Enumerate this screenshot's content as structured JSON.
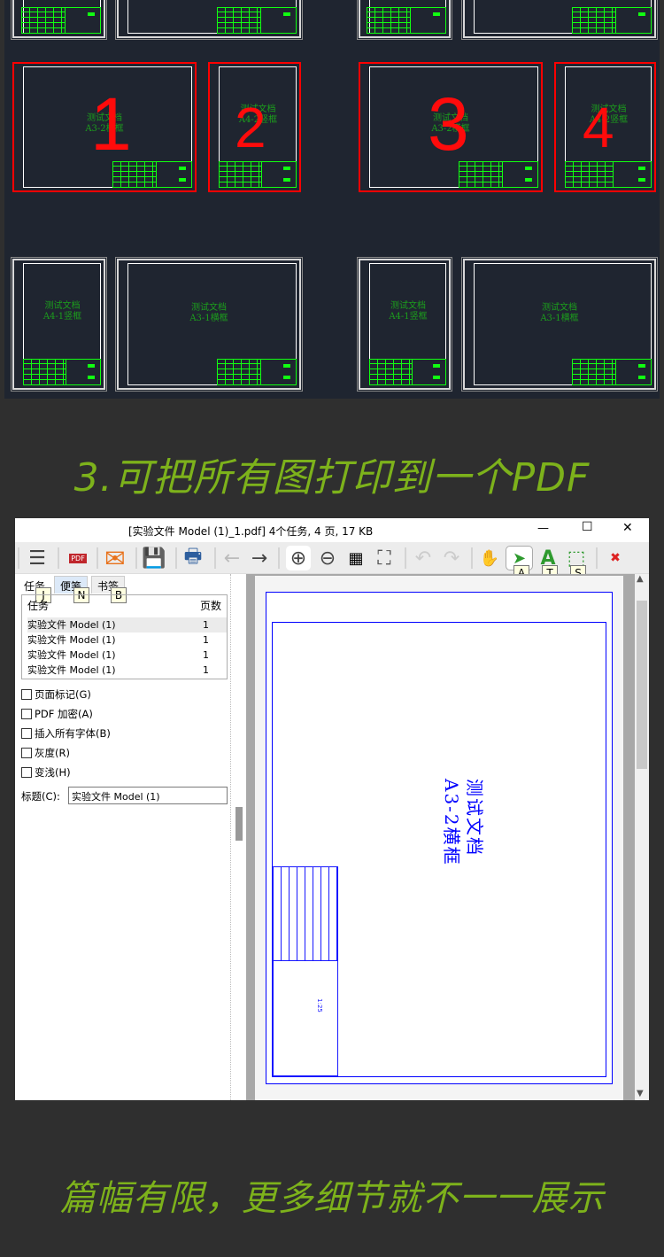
{
  "cad": {
    "frames": [
      {
        "label1": "测试文档",
        "label2": "A3-2横框",
        "number": "1"
      },
      {
        "label1": "测试文档",
        "label2": "A4-2竖框",
        "number": "2"
      },
      {
        "label1": "测试文档",
        "label2": "A3-2横框",
        "number": "3"
      },
      {
        "label1": "测试文档",
        "label2": "A4-2竖框",
        "number": "4"
      },
      {
        "label1": "测试文档",
        "label2": "A4-1竖框"
      },
      {
        "label1": "测试文档",
        "label2": "A3-1横框"
      },
      {
        "label1": "测试文档",
        "label2": "A4-1竖框"
      },
      {
        "label1": "测试文档",
        "label2": "A3-1横框"
      }
    ],
    "colors": {
      "background": "#1f2530",
      "line": "#11ff11",
      "selection": "#ff0000"
    }
  },
  "headline1": "3.可把所有图打印到一个PDF",
  "headline2": "篇幅有限，更多细节就不一一展示",
  "window": {
    "title": "[实验文件 Model (1)_1.pdf] 4个任务, 4 页, 17 KB",
    "controls": {
      "minimize": "—",
      "maximize": "☐",
      "close": "✕"
    },
    "toolbar": {
      "menu": "☰",
      "pdf_icon": "PDF",
      "mail": "✉",
      "save": "💾",
      "print": "🖶",
      "back": "←",
      "forward": "→",
      "zoom_in": "⊕",
      "zoom_out": "⊖",
      "grid": "▦",
      "fit": "⛶",
      "undo": "↶",
      "redo": "↷",
      "hand": "✋",
      "select": "➤",
      "text": "A",
      "area": "⬚",
      "delete": "✖",
      "keytips": {
        "select": "A",
        "text": "T",
        "area": "S"
      }
    },
    "tabs": [
      {
        "label": "任务",
        "key": "J"
      },
      {
        "label": "便笺",
        "key": "N"
      },
      {
        "label": "书签",
        "key": "B"
      }
    ],
    "task_table": {
      "headers": [
        "任务",
        "页数"
      ],
      "rows": [
        {
          "name": "实验文件 Model (1)",
          "pages": "1"
        },
        {
          "name": "实验文件 Model (1)",
          "pages": "1"
        },
        {
          "name": "实验文件 Model (1)",
          "pages": "1"
        },
        {
          "name": "实验文件 Model (1)",
          "pages": "1"
        }
      ]
    },
    "options": [
      {
        "label": "页面标记(G)",
        "checked": false
      },
      {
        "label": "PDF 加密(A)",
        "checked": false
      },
      {
        "label": "插入所有字体(B)",
        "checked": false
      },
      {
        "label": "灰度(R)",
        "checked": false
      },
      {
        "label": "变浅(H)",
        "checked": false
      }
    ],
    "title_field": {
      "label": "标题(C):",
      "value": "实验文件 Model (1)"
    },
    "preview": {
      "line1": "测试文档",
      "line2": "A3-2横框",
      "scale": "1:25"
    }
  }
}
